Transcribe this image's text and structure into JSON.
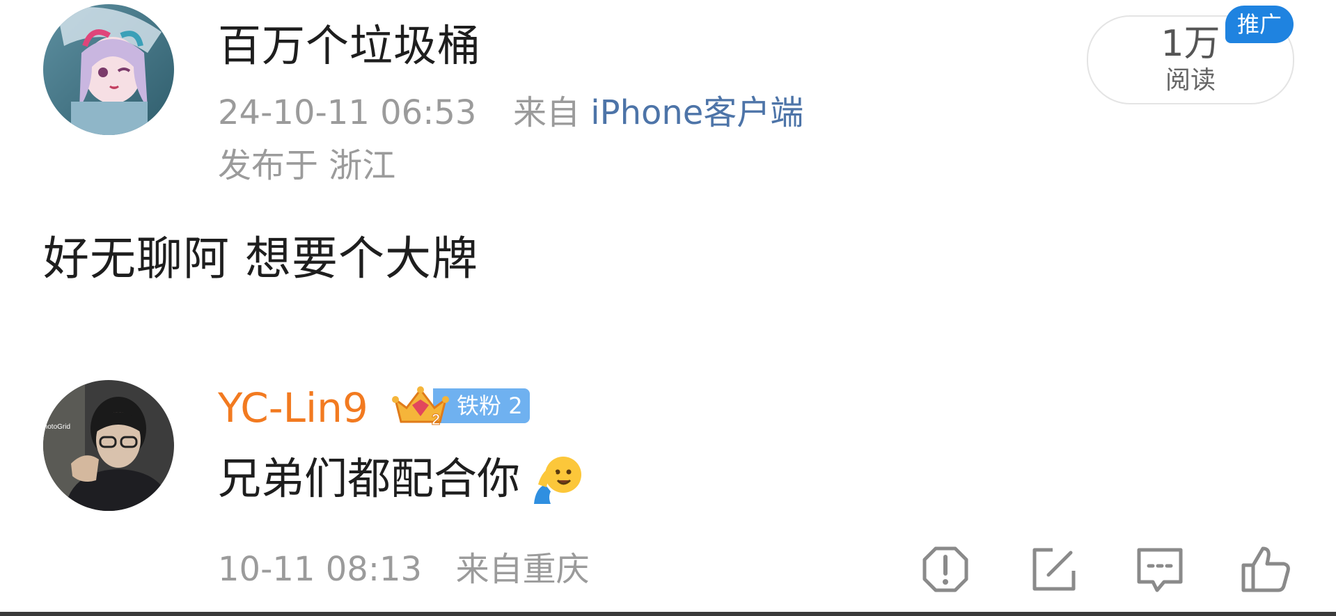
{
  "post": {
    "author": "百万个垃圾桶",
    "time": "24-10-11 06:53",
    "from_prefix": "来自",
    "source": "iPhone客户端",
    "location": "发布于 浙江",
    "body": "好无聊阿 想要个大牌",
    "read_count": "1万",
    "read_label": "阅读",
    "promo_label": "推广"
  },
  "reply": {
    "author": "YC-Lin9",
    "fan_badge": "铁粉",
    "fan_level": "2",
    "crown_level": "2",
    "avatar_watermark": "PhotoGrid",
    "body": "兄弟们都配合你",
    "time": "10-11 08:13",
    "from_location": "来自重庆"
  },
  "actions": [
    {
      "icon": "report-icon"
    },
    {
      "icon": "share-icon"
    },
    {
      "icon": "comment-icon"
    },
    {
      "icon": "like-icon"
    }
  ],
  "colors": {
    "author_orange": "#f27a20",
    "source_blue": "#4d74a8",
    "promo_blue": "#1f83e0",
    "fan_blue": "#6fb1f0",
    "meta_gray": "#9b9b9b"
  }
}
